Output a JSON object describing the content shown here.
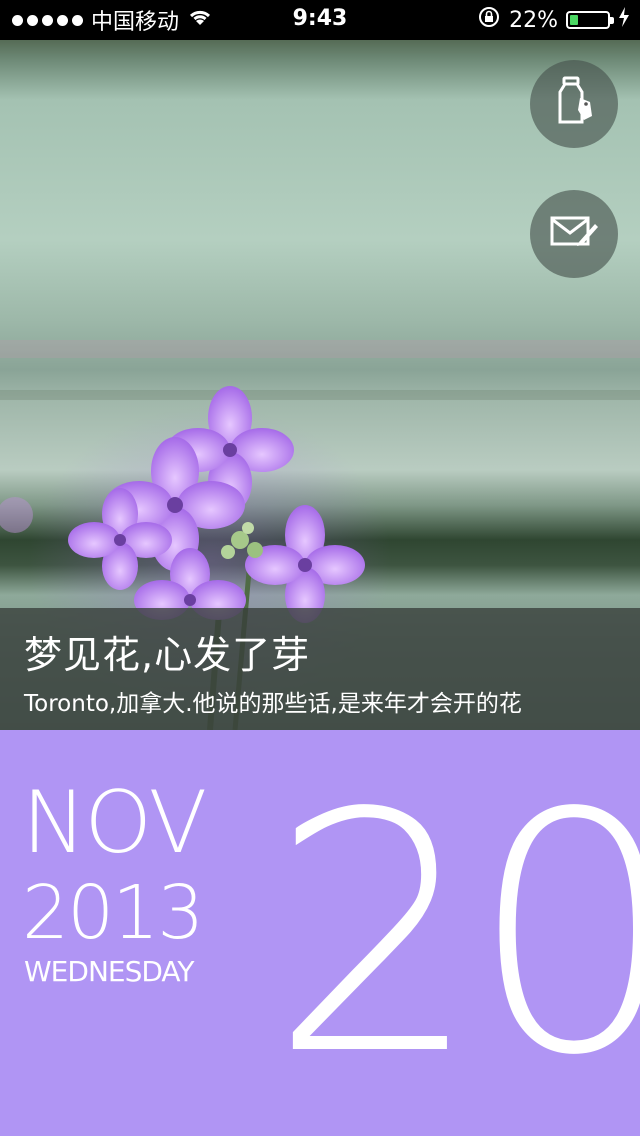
{
  "status_bar": {
    "carrier": "中国移动",
    "time": "9:43",
    "battery": "22%",
    "battery_level": 0.22,
    "signal_icon": "signal-dots-icon",
    "wifi_icon": "wifi-icon",
    "lock_icon": "rotation-lock-icon",
    "charging_icon": "charging-bolt-icon"
  },
  "actions": {
    "bottle_icon": "message-bottle-icon",
    "mail_icon": "compose-mail-icon"
  },
  "caption": {
    "title": "梦见花,心发了芽",
    "subtitle": "Toronto,加拿大.他说的那些话,是来年才会开的花"
  },
  "date": {
    "month": "NOV",
    "year": "2013",
    "weekday": "WEDNESDAY",
    "day": "20"
  },
  "colors": {
    "date_panel": "#b095f4",
    "caption_overlay": "#373e3a",
    "battery_fill": "#4cd964"
  }
}
